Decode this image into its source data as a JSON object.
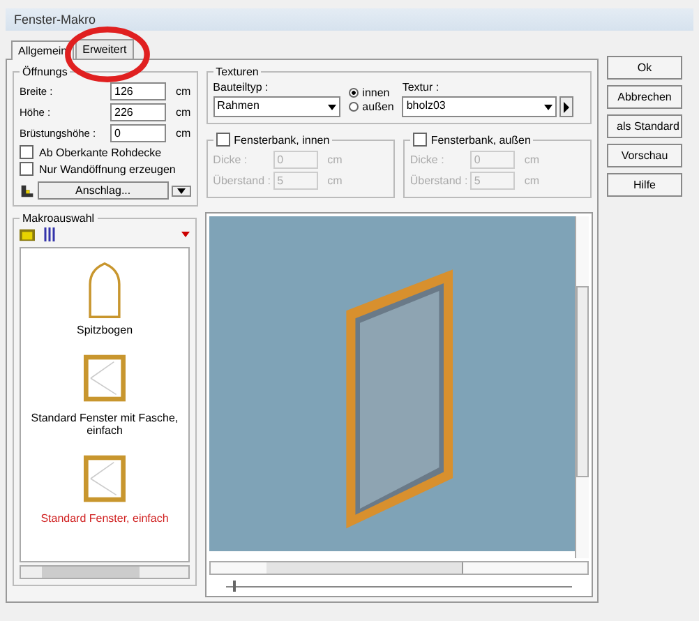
{
  "window": {
    "title": "Fenster-Makro"
  },
  "tabs": [
    {
      "label": "Allgemein",
      "selected": true
    },
    {
      "label": "Erweitert",
      "selected": false
    }
  ],
  "opening": {
    "title": "Öffnungs",
    "fields": [
      {
        "label": "Breite :",
        "value": "126",
        "unit": "cm"
      },
      {
        "label": "Höhe :",
        "value": "226",
        "unit": "cm"
      },
      {
        "label": "Brüstungshöhe :",
        "value": "0",
        "unit": "cm"
      }
    ],
    "checkboxes": [
      {
        "label": "Ab Oberkante Rohdecke",
        "checked": false
      },
      {
        "label": "Nur Wandöffnung erzeugen",
        "checked": false
      }
    ],
    "split_button": {
      "label": "Anschlag..."
    }
  },
  "textures": {
    "title": "Texturen",
    "part_label": "Bauteiltyp :",
    "part_value": "Rahmen",
    "radios": [
      {
        "label": "innen",
        "selected": true
      },
      {
        "label": "außen",
        "selected": false
      }
    ],
    "texture_label": "Textur :",
    "texture_value": "bholz03"
  },
  "sills": [
    {
      "label": "Fensterbank, innen",
      "checked": false,
      "fields": [
        {
          "label": "Dicke :",
          "value": "0",
          "unit": "cm"
        },
        {
          "label": "Überstand :",
          "value": "5",
          "unit": "cm"
        }
      ]
    },
    {
      "label": "Fensterbank, außen",
      "checked": false,
      "fields": [
        {
          "label": "Dicke :",
          "value": "0",
          "unit": "cm"
        },
        {
          "label": "Überstand :",
          "value": "5",
          "unit": "cm"
        }
      ]
    }
  ],
  "macros": {
    "title": "Makroauswahl",
    "items": [
      {
        "label": "Spitzbogen",
        "kind": "arch",
        "selected": false
      },
      {
        "label": "Standard Fenster mit Fasche, einfach",
        "kind": "frame",
        "selected": false
      },
      {
        "label": "Standard Fenster, einfach",
        "kind": "frame",
        "selected": true
      }
    ]
  },
  "zoom_slider": {
    "level": 0.02
  },
  "buttons": [
    "Ok",
    "Abbrechen",
    "als Standard",
    "Vorschau",
    "Hilfe"
  ]
}
